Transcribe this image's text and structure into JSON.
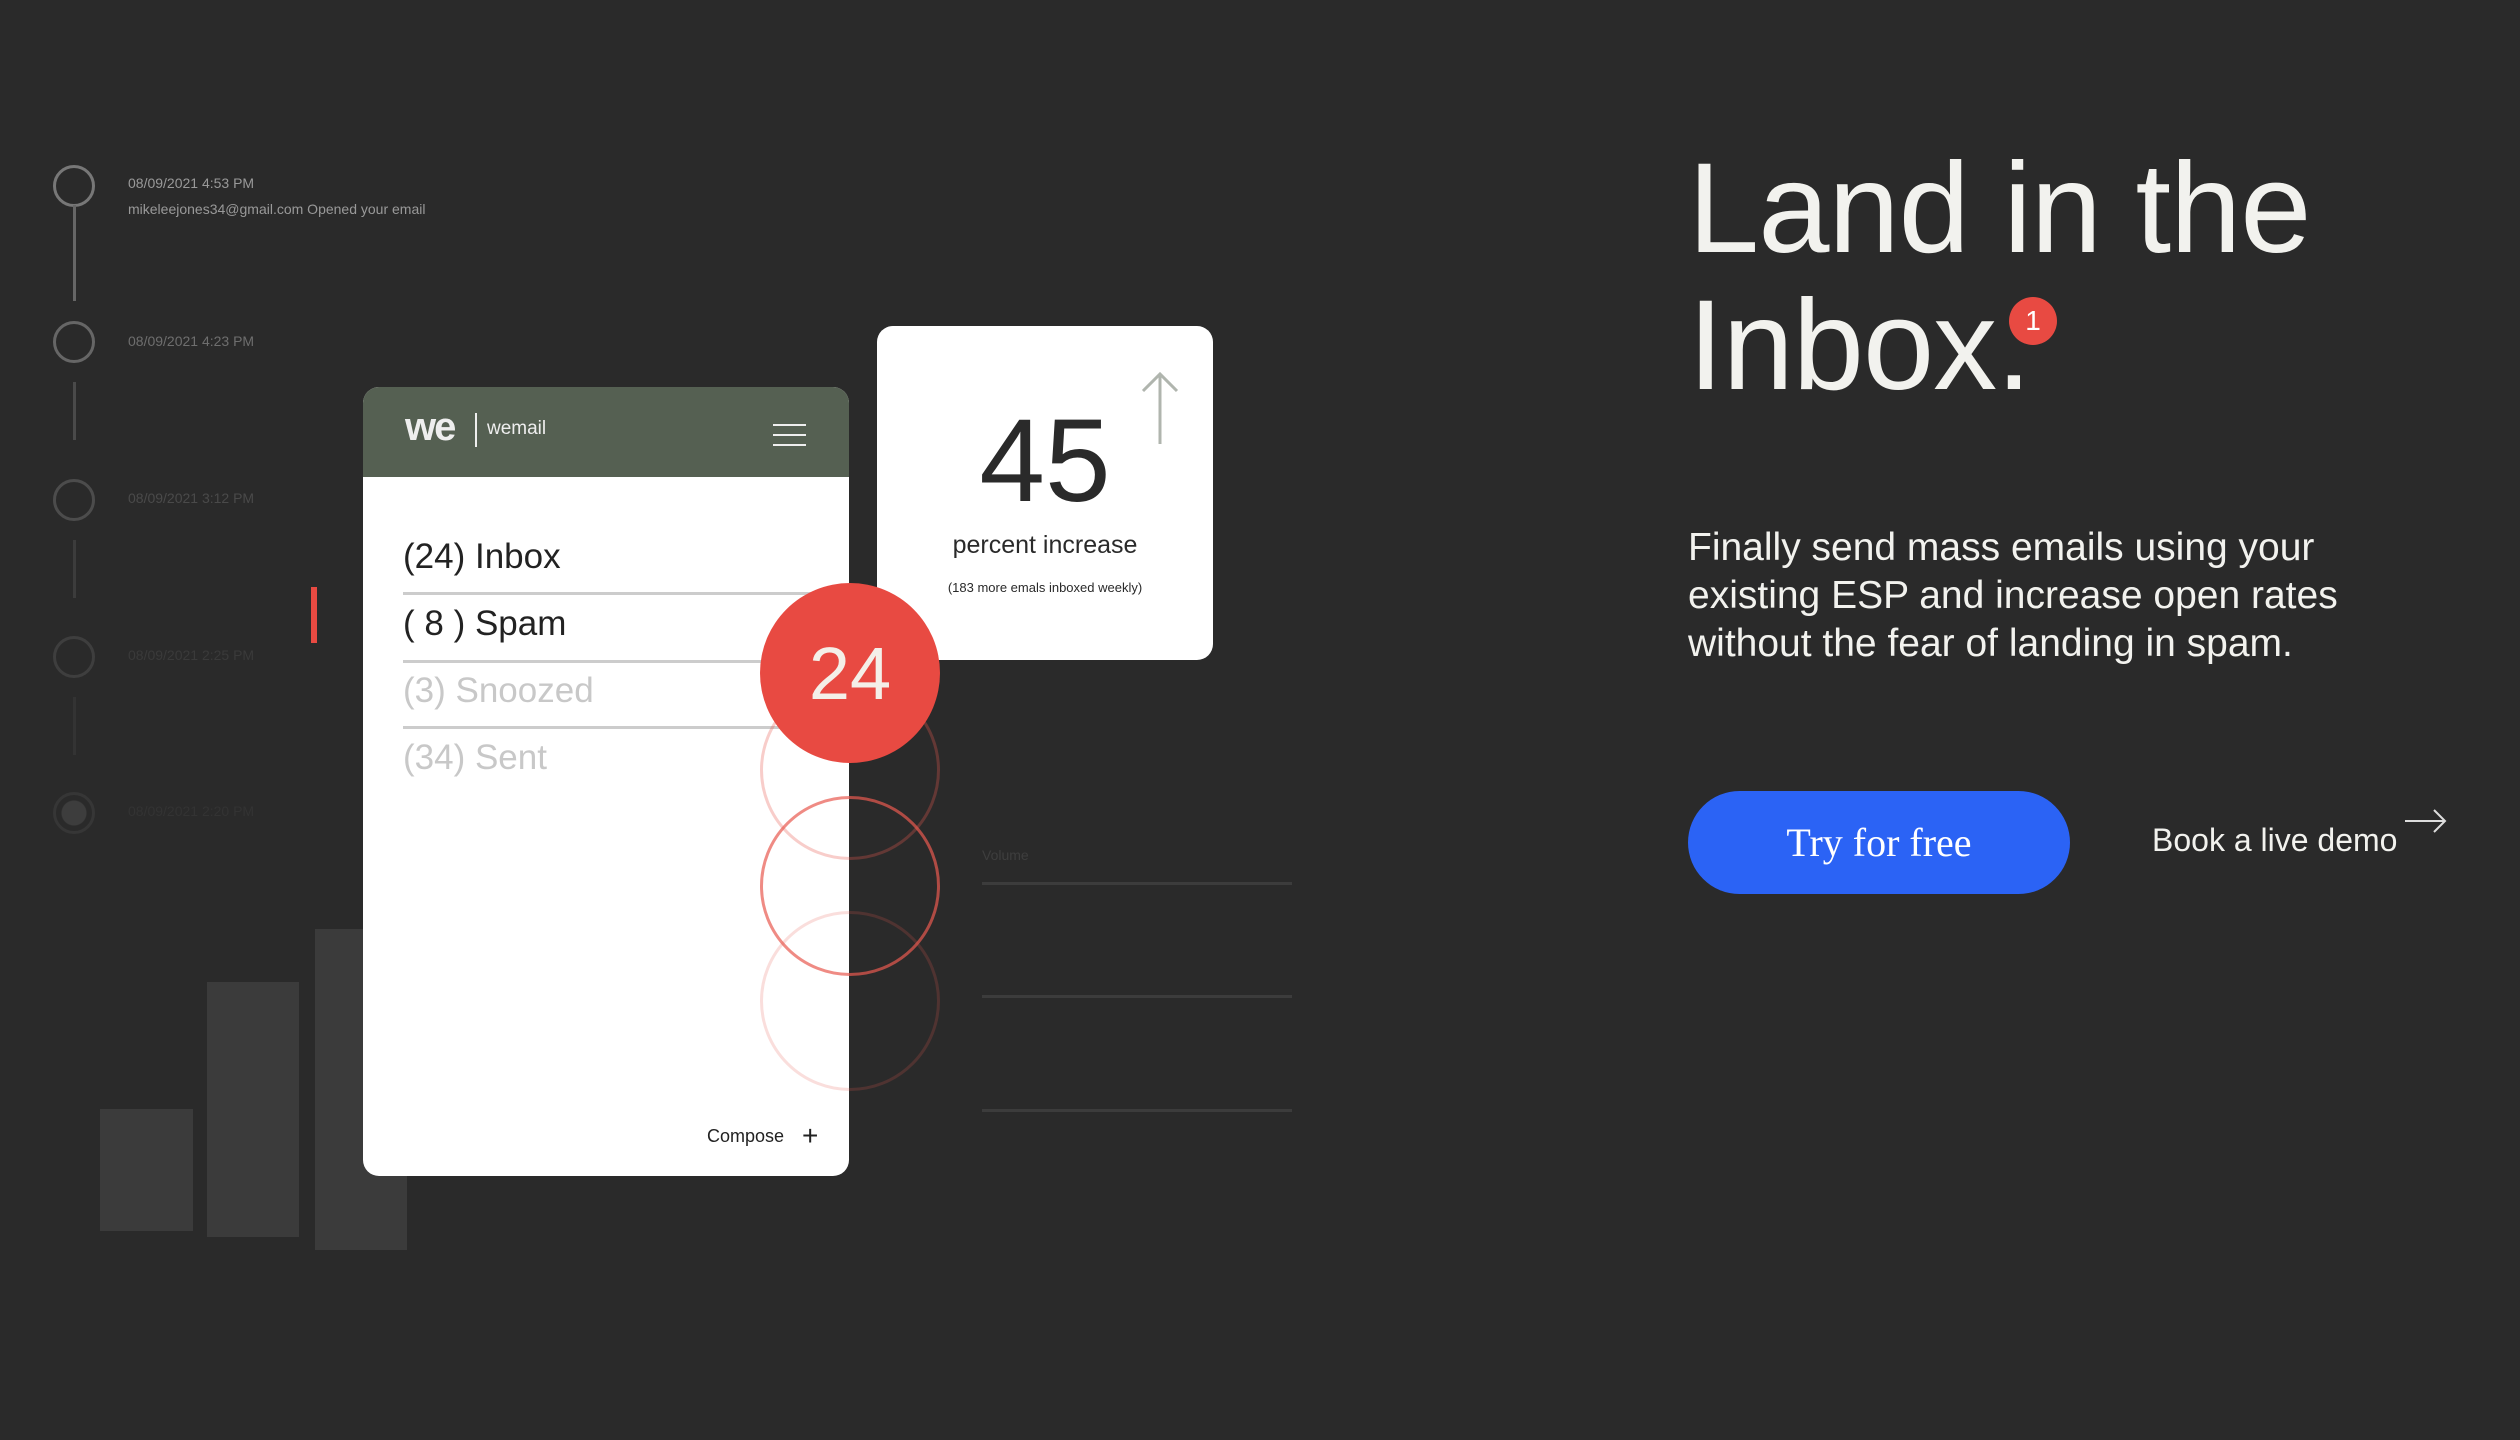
{
  "timeline": [
    {
      "time": "08/09/2021 4:53 PM",
      "detail": "mikeleejones34@gmail.com Opened your email"
    },
    {
      "time": "08/09/2021 4:23 PM"
    },
    {
      "time": "08/09/2021 3:12 PM"
    },
    {
      "time": "08/09/2021 2:25 PM"
    },
    {
      "time": "08/09/2021 2:20 PM"
    }
  ],
  "app": {
    "logo": "we",
    "name": "wemail",
    "folders": [
      {
        "label": "(24) Inbox",
        "active": true
      },
      {
        "label": "( 8 ) Spam",
        "active": true
      },
      {
        "label": "(3) Snoozed",
        "active": false
      },
      {
        "label": "(34) Sent",
        "active": false
      }
    ],
    "compose": "Compose",
    "badge": "24"
  },
  "stat": {
    "value": "45",
    "label": "percent increase",
    "note": "(183 more emals inboxed weekly)"
  },
  "volume": {
    "label": "Volume"
  },
  "hero": {
    "title_line1": "Land in the",
    "title_line2": "Inbox.",
    "notification": "1",
    "description": "Finally send mass emails using your existing ESP and increase open rates without the fear of landing in spam.",
    "cta_primary": "Try for free",
    "cta_secondary": "Book a live demo"
  },
  "colors": {
    "accent": "#2b63f5",
    "red": "#e84a42",
    "header": "#556052",
    "background": "#2a2a2a"
  }
}
